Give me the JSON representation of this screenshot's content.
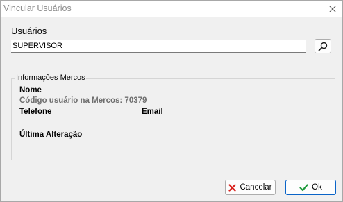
{
  "window": {
    "title": "Vincular Usuários",
    "close_icon": "close-icon"
  },
  "users": {
    "label": "Usuários",
    "value": "SUPERVISOR",
    "search_icon": "search-icon"
  },
  "info_group": {
    "legend": "Informações Mercos",
    "name_label": "Nome",
    "code_text": "Código usuário na Mercos: 70379",
    "phone_label": "Telefone",
    "email_label": "Email",
    "last_change_label": "Última Alteração"
  },
  "buttons": {
    "cancel_label": "Cancelar",
    "cancel_icon": "x-icon",
    "cancel_icon_color": "#d9201c",
    "ok_label": "Ok",
    "ok_icon": "check-icon",
    "ok_icon_color": "#1e9a3c"
  }
}
